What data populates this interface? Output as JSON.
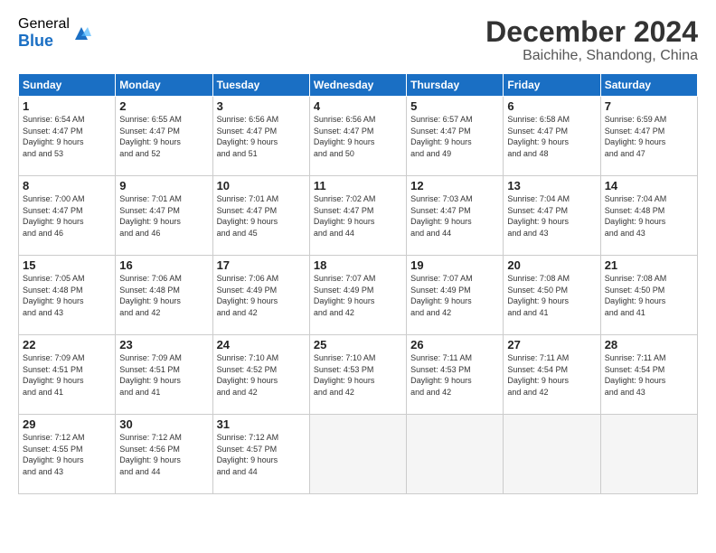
{
  "logo": {
    "general": "General",
    "blue": "Blue"
  },
  "title": "December 2024",
  "location": "Baichihe, Shandong, China",
  "headers": [
    "Sunday",
    "Monday",
    "Tuesday",
    "Wednesday",
    "Thursday",
    "Friday",
    "Saturday"
  ],
  "weeks": [
    [
      {
        "day": "1",
        "sunrise": "6:54 AM",
        "sunset": "4:47 PM",
        "daylight": "9 hours and 53 minutes."
      },
      {
        "day": "2",
        "sunrise": "6:55 AM",
        "sunset": "4:47 PM",
        "daylight": "9 hours and 52 minutes."
      },
      {
        "day": "3",
        "sunrise": "6:56 AM",
        "sunset": "4:47 PM",
        "daylight": "9 hours and 51 minutes."
      },
      {
        "day": "4",
        "sunrise": "6:56 AM",
        "sunset": "4:47 PM",
        "daylight": "9 hours and 50 minutes."
      },
      {
        "day": "5",
        "sunrise": "6:57 AM",
        "sunset": "4:47 PM",
        "daylight": "9 hours and 49 minutes."
      },
      {
        "day": "6",
        "sunrise": "6:58 AM",
        "sunset": "4:47 PM",
        "daylight": "9 hours and 48 minutes."
      },
      {
        "day": "7",
        "sunrise": "6:59 AM",
        "sunset": "4:47 PM",
        "daylight": "9 hours and 47 minutes."
      }
    ],
    [
      {
        "day": "8",
        "sunrise": "7:00 AM",
        "sunset": "4:47 PM",
        "daylight": "9 hours and 46 minutes."
      },
      {
        "day": "9",
        "sunrise": "7:01 AM",
        "sunset": "4:47 PM",
        "daylight": "9 hours and 46 minutes."
      },
      {
        "day": "10",
        "sunrise": "7:01 AM",
        "sunset": "4:47 PM",
        "daylight": "9 hours and 45 minutes."
      },
      {
        "day": "11",
        "sunrise": "7:02 AM",
        "sunset": "4:47 PM",
        "daylight": "9 hours and 44 minutes."
      },
      {
        "day": "12",
        "sunrise": "7:03 AM",
        "sunset": "4:47 PM",
        "daylight": "9 hours and 44 minutes."
      },
      {
        "day": "13",
        "sunrise": "7:04 AM",
        "sunset": "4:47 PM",
        "daylight": "9 hours and 43 minutes."
      },
      {
        "day": "14",
        "sunrise": "7:04 AM",
        "sunset": "4:48 PM",
        "daylight": "9 hours and 43 minutes."
      }
    ],
    [
      {
        "day": "15",
        "sunrise": "7:05 AM",
        "sunset": "4:48 PM",
        "daylight": "9 hours and 43 minutes."
      },
      {
        "day": "16",
        "sunrise": "7:06 AM",
        "sunset": "4:48 PM",
        "daylight": "9 hours and 42 minutes."
      },
      {
        "day": "17",
        "sunrise": "7:06 AM",
        "sunset": "4:49 PM",
        "daylight": "9 hours and 42 minutes."
      },
      {
        "day": "18",
        "sunrise": "7:07 AM",
        "sunset": "4:49 PM",
        "daylight": "9 hours and 42 minutes."
      },
      {
        "day": "19",
        "sunrise": "7:07 AM",
        "sunset": "4:49 PM",
        "daylight": "9 hours and 42 minutes."
      },
      {
        "day": "20",
        "sunrise": "7:08 AM",
        "sunset": "4:50 PM",
        "daylight": "9 hours and 41 minutes."
      },
      {
        "day": "21",
        "sunrise": "7:08 AM",
        "sunset": "4:50 PM",
        "daylight": "9 hours and 41 minutes."
      }
    ],
    [
      {
        "day": "22",
        "sunrise": "7:09 AM",
        "sunset": "4:51 PM",
        "daylight": "9 hours and 41 minutes."
      },
      {
        "day": "23",
        "sunrise": "7:09 AM",
        "sunset": "4:51 PM",
        "daylight": "9 hours and 41 minutes."
      },
      {
        "day": "24",
        "sunrise": "7:10 AM",
        "sunset": "4:52 PM",
        "daylight": "9 hours and 42 minutes."
      },
      {
        "day": "25",
        "sunrise": "7:10 AM",
        "sunset": "4:53 PM",
        "daylight": "9 hours and 42 minutes."
      },
      {
        "day": "26",
        "sunrise": "7:11 AM",
        "sunset": "4:53 PM",
        "daylight": "9 hours and 42 minutes."
      },
      {
        "day": "27",
        "sunrise": "7:11 AM",
        "sunset": "4:54 PM",
        "daylight": "9 hours and 42 minutes."
      },
      {
        "day": "28",
        "sunrise": "7:11 AM",
        "sunset": "4:54 PM",
        "daylight": "9 hours and 43 minutes."
      }
    ],
    [
      {
        "day": "29",
        "sunrise": "7:12 AM",
        "sunset": "4:55 PM",
        "daylight": "9 hours and 43 minutes."
      },
      {
        "day": "30",
        "sunrise": "7:12 AM",
        "sunset": "4:56 PM",
        "daylight": "9 hours and 44 minutes."
      },
      {
        "day": "31",
        "sunrise": "7:12 AM",
        "sunset": "4:57 PM",
        "daylight": "9 hours and 44 minutes."
      },
      null,
      null,
      null,
      null
    ]
  ],
  "labels": {
    "sunrise": "Sunrise:",
    "sunset": "Sunset:",
    "daylight": "Daylight:"
  }
}
